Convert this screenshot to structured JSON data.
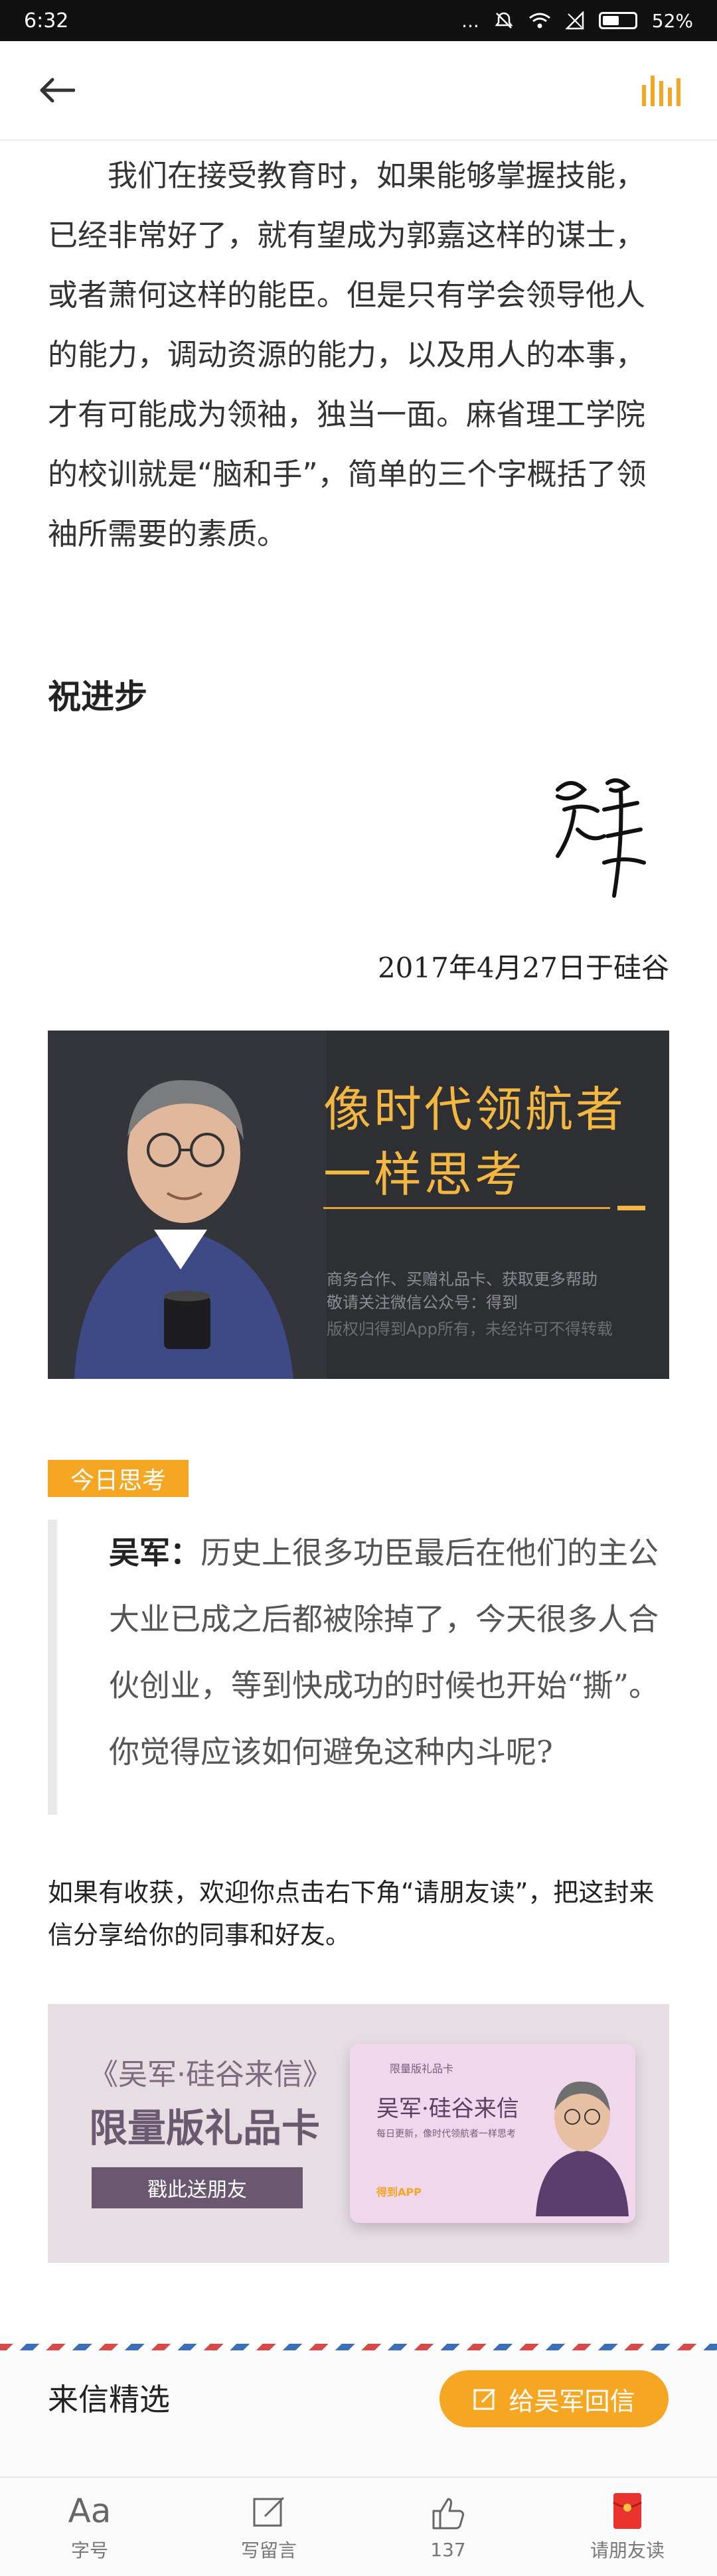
{
  "status_bar": {
    "time": "6:32",
    "dots": "...",
    "battery": "52%"
  },
  "paragraph": "我们在接受教育时，如果能够掌握技能，已经非常好了，就有望成为郭嘉这样的谋士，或者萧何这样的能臣。但是只有学会领导他人的能力，调动资源的能力，以及用人的本事，才有可能成为领袖，独当一面。麻省理工学院的校训就是“脑和手”，简单的三个字概括了领袖所需要的素质。",
  "greeting": "祝进步",
  "date_line": "2017年4月27日于硅谷",
  "banner1": {
    "title_line1": "像时代领航者",
    "title_line2": "一样思考",
    "small_line1": "商务合作、买赠礼品卡、获取更多帮助",
    "small_line2": "敬请关注微信公众号：得到",
    "small_line3": "版权归得到App所有，未经许可不得转载"
  },
  "thinking": {
    "tag": "今日思考",
    "author": "吴军：",
    "text": "历史上很多功臣最后在他们的主公大业已成之后都被除掉了，今天很多人合伙创业，等到快成功的时候也开始“撕”。你觉得应该如何避免这种内斗呢?"
  },
  "share_note": "如果有收获，欢迎你点击右下角“请朋友读”，把这封来信分享给你的同事和好友。",
  "banner2": {
    "title1": "《吴军·硅谷来信》",
    "title2": "限量版礼品卡",
    "button": "戳此送朋友",
    "card_top": "限量版礼品卡",
    "card_title": "吴军·硅谷来信",
    "card_sub": "每日更新，像时代领航者一样思考",
    "card_logo": "得到APP"
  },
  "bottom": {
    "featured": "来信精选",
    "reply": "给吴军回信"
  },
  "tabs": [
    {
      "label": "字号",
      "glyph": "Aa",
      "icon": "font-size-icon"
    },
    {
      "label": "写留言",
      "icon": "compose-icon"
    },
    {
      "label": "137",
      "icon": "thumbs-up-icon"
    },
    {
      "label": "请朋友读",
      "icon": "red-envelope-icon"
    }
  ],
  "colors": {
    "accent": "#f5a623",
    "banner_dark": "#2e2f33",
    "gift_bg": "#e7dee4"
  }
}
